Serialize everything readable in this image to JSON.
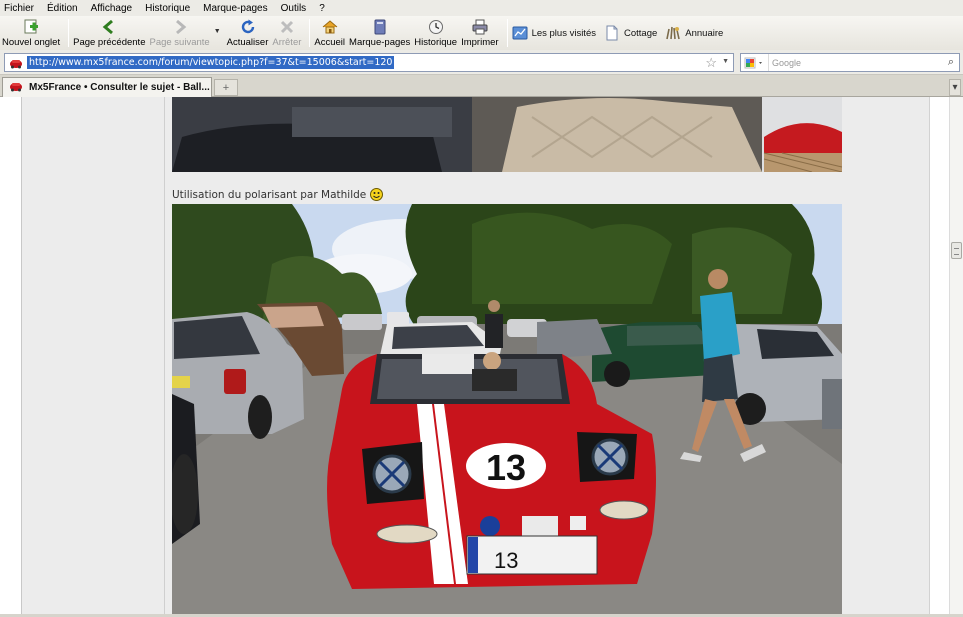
{
  "menu": [
    "Fichier",
    "Édition",
    "Affichage",
    "Historique",
    "Marque-pages",
    "Outils",
    "?"
  ],
  "toolbar": {
    "new_tab": "Nouvel onglet",
    "back": "Page précédente",
    "forward": "Page suivante",
    "reload": "Actualiser",
    "stop": "Arrêter",
    "home": "Accueil",
    "bookmarks": "Marque-pages",
    "history": "Historique",
    "print": "Imprimer"
  },
  "bookmarks_bar": [
    "Les plus visités",
    "Cottage",
    "Annuaire"
  ],
  "address": {
    "url": "http://www.mx5france.com/forum/viewtopic.php?f=37&t=15006&start=120"
  },
  "search": {
    "placeholder": "Google"
  },
  "tabs": {
    "active_title": "Mx5France • Consulter le sujet - Ball...",
    "new_tab_symbol": "+",
    "list_symbol": "▾"
  },
  "post": {
    "caption": "Utilisation du polarisant par Mathilde",
    "plate": "13",
    "race_number": "13"
  },
  "colors": {
    "accent": "#316ac5",
    "car_red": "#c8141c",
    "sky": "#c9d9ef"
  }
}
